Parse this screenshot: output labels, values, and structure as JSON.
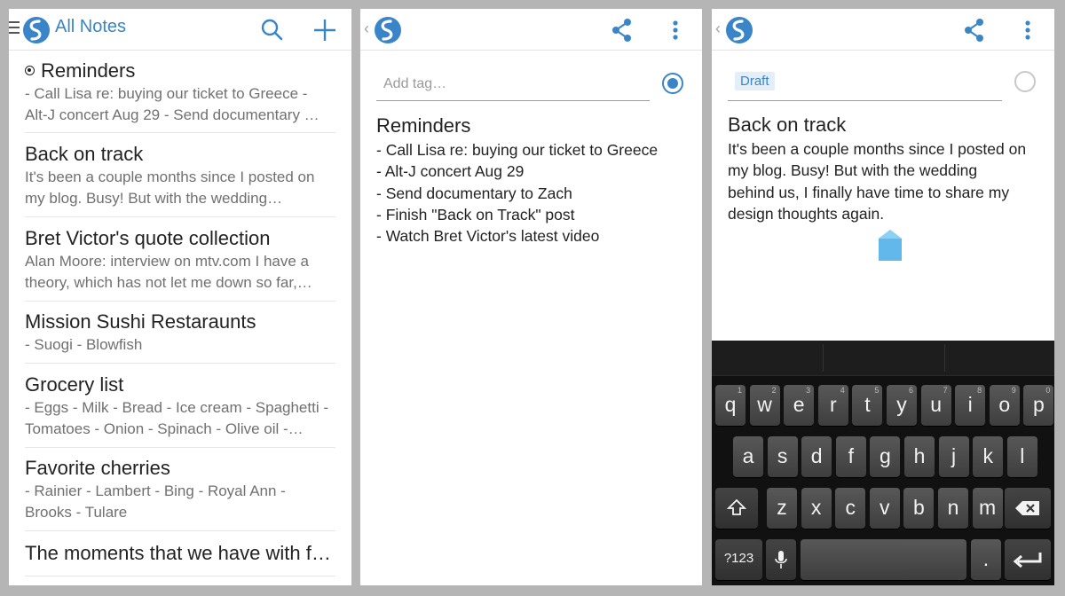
{
  "colors": {
    "accent": "#3a85c7",
    "tag_chip_bg": "#e3eef9",
    "keyboard_bg": "#111111"
  },
  "list_screen": {
    "title": "All Notes",
    "icons": {
      "menu": "hamburger-icon",
      "logo": "simplenote-logo",
      "search": "search-icon",
      "add": "plus-icon"
    },
    "notes": [
      {
        "title": "Reminders",
        "pinned": true,
        "preview": [
          "- Call Lisa re: buying our ticket to Greece -",
          "Alt-J concert Aug 29 - Send documentary …"
        ]
      },
      {
        "title": "Back on track",
        "pinned": false,
        "preview": [
          "It's been a couple months since I posted on",
          "my blog. Busy! But with the wedding…"
        ]
      },
      {
        "title": "Bret Victor's quote collection",
        "pinned": false,
        "preview": [
          "Alan Moore: interview on mtv.com I have a",
          "theory, which has not let me down so far,…"
        ]
      },
      {
        "title": "Mission Sushi Restaraunts",
        "pinned": false,
        "preview": [
          "- Suogi - Blowfish"
        ]
      },
      {
        "title": "Grocery list",
        "pinned": false,
        "preview": [
          "- Eggs - Milk - Bread - Ice cream - Spaghetti -",
          "Tomatoes - Onion - Spinach - Olive oil -…"
        ]
      },
      {
        "title": "Favorite cherries",
        "pinned": false,
        "preview": [
          "- Rainier - Lambert - Bing - Royal Ann -",
          "Brooks - Tulare"
        ]
      },
      {
        "title": "The moments that we have with f…",
        "pinned": false,
        "preview": []
      }
    ]
  },
  "note_screen_reminders": {
    "icons": {
      "back": "back-chevron-icon",
      "logo": "simplenote-logo",
      "share": "share-icon",
      "overflow": "overflow-menu-icon"
    },
    "tag_placeholder": "Add tag…",
    "pinned": true,
    "title": "Reminders",
    "lines": [
      "- Call Lisa re: buying our ticket to Greece",
      "- Alt-J concert Aug 29",
      "- Send documentary to Zach",
      "- Finish \"Back on Track\" post",
      "- Watch Bret Victor's latest video"
    ]
  },
  "note_screen_back_on_track": {
    "icons": {
      "back": "back-chevron-icon",
      "logo": "simplenote-logo",
      "share": "share-icon",
      "overflow": "overflow-menu-icon"
    },
    "tag": "Draft",
    "pinned": false,
    "title": "Back on track",
    "lines": [
      "It's been a couple months since I posted on",
      "my blog. Busy! But with the wedding",
      "behind us, I finally have time to share my",
      "design thoughts again."
    ],
    "keyboard": {
      "row1": [
        {
          "key": "q",
          "sup": "1"
        },
        {
          "key": "w",
          "sup": "2"
        },
        {
          "key": "e",
          "sup": "3"
        },
        {
          "key": "r",
          "sup": "4"
        },
        {
          "key": "t",
          "sup": "5"
        },
        {
          "key": "y",
          "sup": "6"
        },
        {
          "key": "u",
          "sup": "7"
        },
        {
          "key": "i",
          "sup": "8"
        },
        {
          "key": "o",
          "sup": "9"
        },
        {
          "key": "p",
          "sup": "0"
        }
      ],
      "row2": [
        "a",
        "s",
        "d",
        "f",
        "g",
        "h",
        "j",
        "k",
        "l"
      ],
      "row3": [
        "z",
        "x",
        "c",
        "v",
        "b",
        "n",
        "m"
      ],
      "symbols_key": "?123",
      "period_key": ".",
      "icons": {
        "shift": "shift-icon",
        "backspace": "backspace-icon",
        "mic": "microphone-icon",
        "enter": "enter-icon"
      }
    }
  }
}
